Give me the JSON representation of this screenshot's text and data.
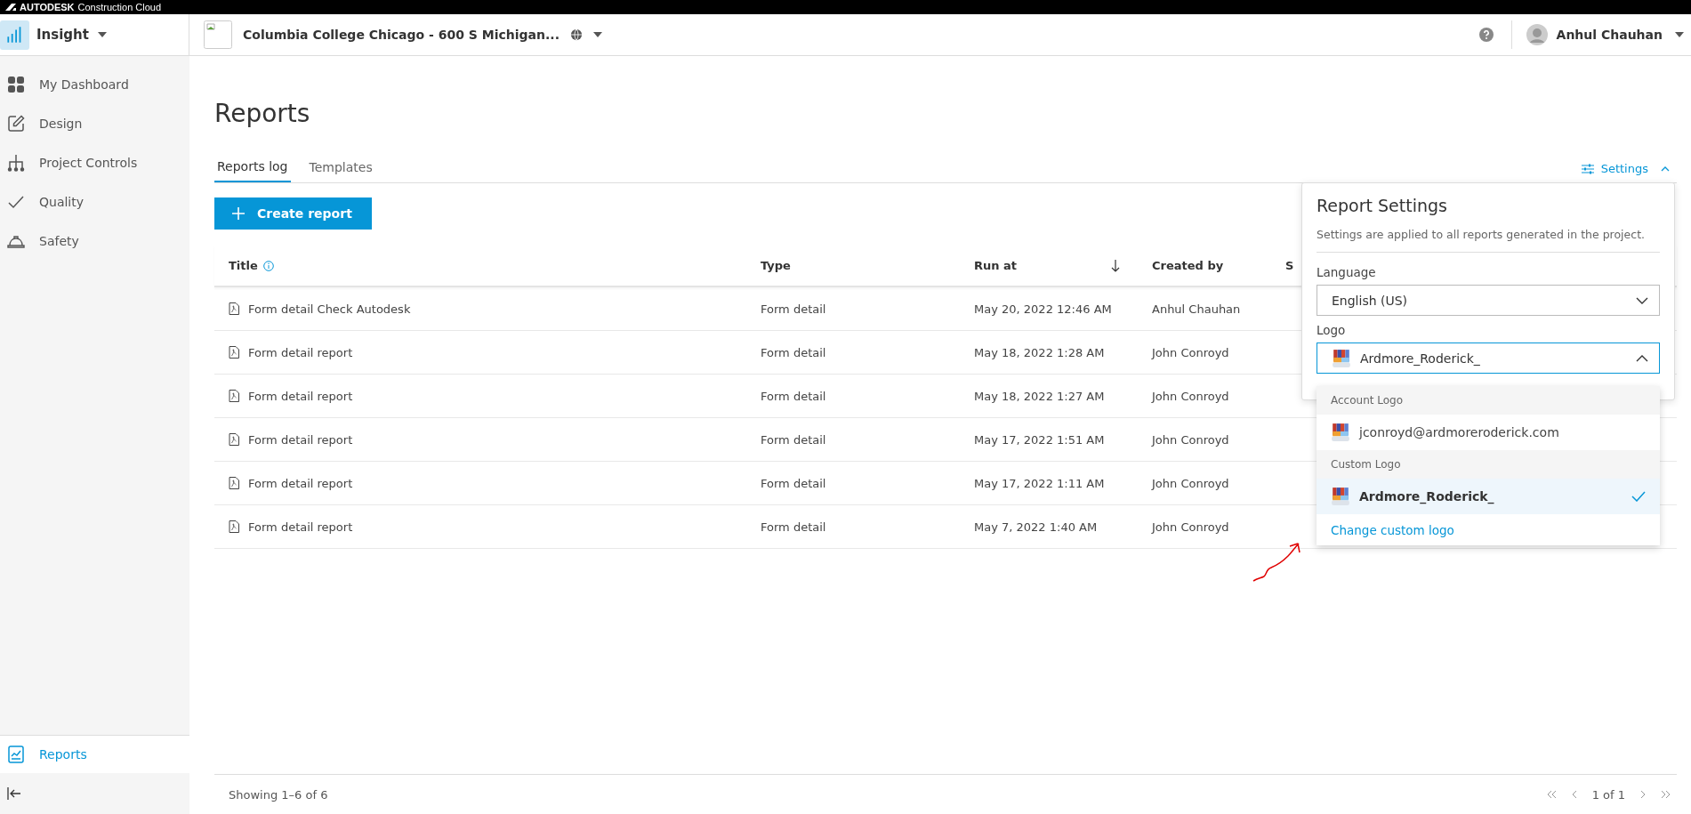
{
  "brand_bar": {
    "brand": "AUTODESK",
    "product": "Construction Cloud"
  },
  "header": {
    "module": "Insight",
    "project": "Columbia College Chicago - 600 S Michigan...",
    "user": "Anhul Chauhan"
  },
  "sidebar": {
    "items": [
      {
        "label": "My Dashboard",
        "kind": "dashboard",
        "selected": false
      },
      {
        "label": "Design",
        "kind": "design",
        "selected": false
      },
      {
        "label": "Project Controls",
        "kind": "controls",
        "selected": false
      },
      {
        "label": "Quality",
        "kind": "quality",
        "selected": false
      },
      {
        "label": "Safety",
        "kind": "safety",
        "selected": false
      }
    ],
    "bottom_items": [
      {
        "label": "Reports",
        "kind": "reports",
        "selected": true
      }
    ]
  },
  "page": {
    "title": "Reports",
    "tabs": [
      {
        "label": "Reports log",
        "selected": true
      },
      {
        "label": "Templates",
        "selected": false
      }
    ],
    "create_button": "Create report",
    "settings_link": {
      "label": "Settings",
      "expanded": true
    }
  },
  "table": {
    "columns": [
      {
        "label": "Title",
        "kind": "info"
      },
      {
        "label": "Type",
        "kind": "plain"
      },
      {
        "label": "Run at",
        "kind": "sorted"
      },
      {
        "label": "Created by",
        "kind": "plain"
      },
      {
        "label": "S",
        "kind": "plain"
      }
    ],
    "rows": [
      {
        "title": "Form detail Check Autodesk",
        "type": "Form detail",
        "run_at": "May 20, 2022 12:46 AM",
        "created_by": "Anhul Chauhan"
      },
      {
        "title": "Form detail report",
        "type": "Form detail",
        "run_at": "May 18, 2022 1:28 AM",
        "created_by": "John Conroyd"
      },
      {
        "title": "Form detail report",
        "type": "Form detail",
        "run_at": "May 18, 2022 1:27 AM",
        "created_by": "John Conroyd"
      },
      {
        "title": "Form detail report",
        "type": "Form detail",
        "run_at": "May 17, 2022 1:51 AM",
        "created_by": "John Conroyd"
      },
      {
        "title": "Form detail report",
        "type": "Form detail",
        "run_at": "May 17, 2022 1:11 AM",
        "created_by": "John Conroyd"
      },
      {
        "title": "Form detail report",
        "type": "Form detail",
        "run_at": "May 7, 2022 1:40 AM",
        "created_by": "John Conroyd"
      }
    ]
  },
  "settings_panel": {
    "title": "Report Settings",
    "description": "Settings are applied to all reports generated in the project.",
    "language_label": "Language",
    "language": "English (US)",
    "logo_label": "Logo",
    "logo": "Ardmore_Roderick_",
    "logo_menu": {
      "groups": [
        {
          "heading": "Account Logo",
          "options": [
            {
              "label": "jconroyd@ardmoreroderick.com",
              "selected": false
            }
          ]
        },
        {
          "heading": "Custom Logo",
          "options": [
            {
              "label": "Ardmore_Roderick_",
              "selected": true
            }
          ]
        }
      ],
      "action": "Change custom logo"
    }
  },
  "footer": {
    "summary": "Showing 1–6 of 6",
    "page": "1 of 1"
  },
  "annotation": {
    "kind": "arrow"
  }
}
